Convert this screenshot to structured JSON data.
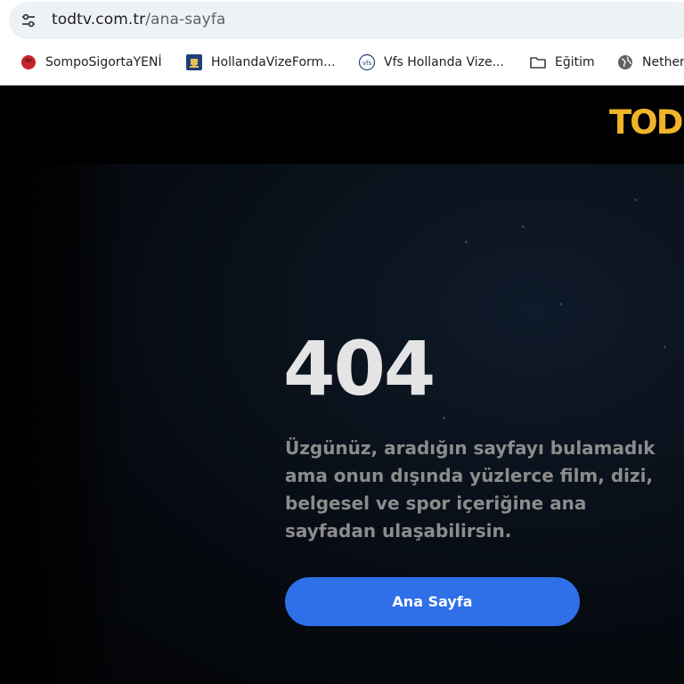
{
  "browser": {
    "url_host": "todtv.com.tr",
    "url_path": "/ana-sayfa",
    "bookmarks": [
      {
        "label": "SompoSigortaYENİ",
        "icon": "sompo-logo-icon"
      },
      {
        "label": "HollandaVizeForm...",
        "icon": "netherlands-crest-icon"
      },
      {
        "label": "Vfs Hollanda Vize...",
        "icon": "vfs-logo-icon"
      },
      {
        "label": "Eğitim",
        "icon": "folder-icon"
      },
      {
        "label": "Nether",
        "icon": "globe-icon"
      }
    ]
  },
  "site": {
    "logo": "TOD",
    "logo_color": "#f0b429"
  },
  "error": {
    "code": "404",
    "message": "Üzgünüz, aradığın sayfayı bulamadık ama onun dışında yüzlerce film, dizi, belgesel ve spor içeriğine ana sayfadan ulaşabilirsin.",
    "button_label": "Ana Sayfa",
    "button_color": "#2f6fe8"
  }
}
